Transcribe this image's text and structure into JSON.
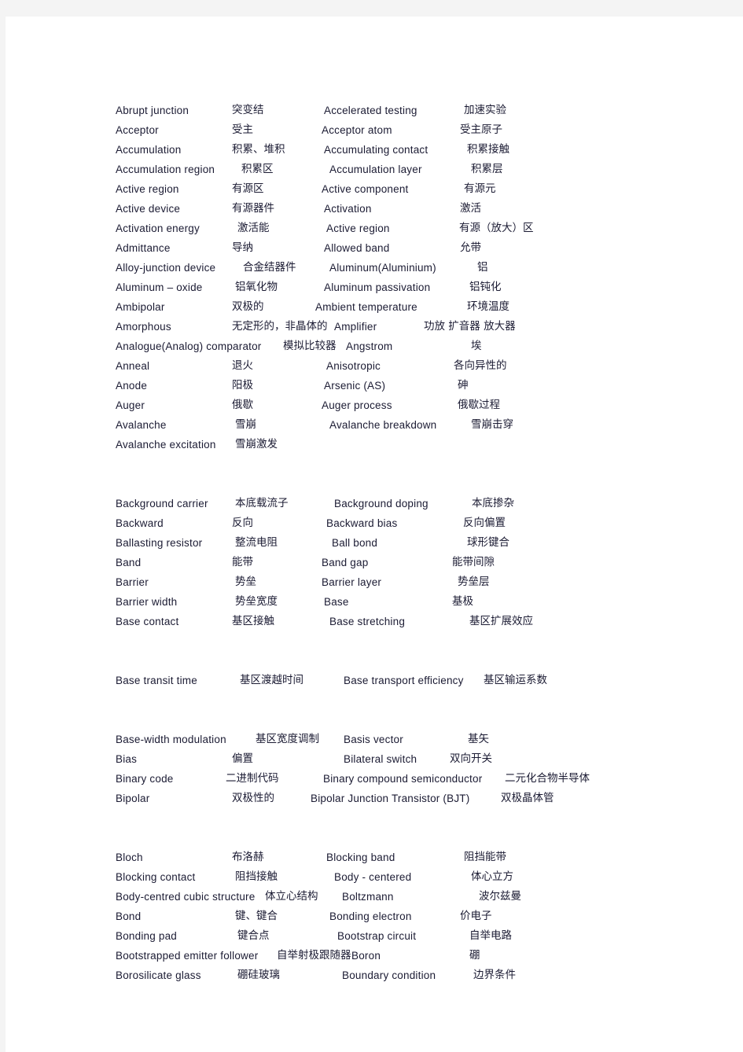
{
  "document": {
    "type": "glossary",
    "description": "English-Chinese semiconductor terminology glossary page",
    "page_background": "#ffffff",
    "margin_background": "#f4f4f4",
    "text_color": "#1b1b33"
  },
  "blocks": [
    {
      "id": "block-a",
      "rows": [
        {
          "term_en": "Abrupt junction",
          "term_zh": "突变结",
          "term2_en": "Accelerated testing",
          "term2_zh": "加速实验",
          "x": [
            0,
            148,
            265,
            443
          ]
        },
        {
          "term_en": "Acceptor",
          "term_zh": "受主",
          "term2_en": "Acceptor atom",
          "term2_zh": "受主原子",
          "x": [
            0,
            148,
            262,
            438
          ]
        },
        {
          "term_en": "Accumulation",
          "term_zh": "积累、堆积",
          "term2_en": "Accumulating contact",
          "term2_zh": "积累接触",
          "x": [
            0,
            148,
            265,
            447
          ]
        },
        {
          "term_en": "Accumulation region",
          "term_zh": "积累区",
          "term2_en": "Accumulation layer",
          "term2_zh": "积累层",
          "x": [
            0,
            160,
            272,
            452
          ]
        },
        {
          "term_en": "Active region",
          "term_zh": "有源区",
          "term2_en": "Active component",
          "term2_zh": "有源元",
          "x": [
            0,
            148,
            262,
            443
          ]
        },
        {
          "term_en": "Active device",
          "term_zh": "有源器件",
          "term2_en": "Activation",
          "term2_zh": "激活",
          "x": [
            0,
            148,
            265,
            438
          ]
        },
        {
          "term_en": "Activation energy",
          "term_zh": "激活能",
          "term2_en": "Active region",
          "term2_zh": "有源（放大）区",
          "x": [
            0,
            155,
            268,
            437
          ]
        },
        {
          "term_en": "Admittance",
          "term_zh": "导纳",
          "term2_en": "Allowed band",
          "term2_zh": "允带",
          "x": [
            0,
            148,
            265,
            438
          ]
        },
        {
          "term_en": "Alloy-junction device",
          "term_zh": "合金结器件",
          "term2_en": "Aluminum(Aluminium)",
          "term2_zh": "铝",
          "x": [
            0,
            162,
            272,
            460
          ]
        },
        {
          "term_en": "Aluminum – oxide",
          "term_zh": "铝氧化物",
          "term2_en": "Aluminum passivation",
          "term2_zh": "铝钝化",
          "x": [
            0,
            152,
            265,
            450
          ]
        },
        {
          "term_en": "Ambipolar",
          "term_zh": "双极的",
          "term2_en": "Ambient temperature",
          "term2_zh": "环境温度",
          "x": [
            0,
            148,
            254,
            447
          ]
        },
        {
          "term_en": "Amorphous",
          "term_zh": "无定形的，非晶体的",
          "term2_en": "Amplifier",
          "term2_zh": "功放 扩音器 放大器",
          "x": [
            0,
            148,
            278,
            392
          ]
        },
        {
          "term_en": "Analogue(Analog) comparator",
          "term_zh": "模拟比较器",
          "term2_en": "Angstrom",
          "term2_zh": "埃",
          "x": [
            0,
            213,
            293,
            452
          ]
        },
        {
          "term_en": "Anneal",
          "term_zh": "退火",
          "term2_en": "Anisotropic",
          "term2_zh": "各向异性的",
          "x": [
            0,
            148,
            268,
            430
          ]
        },
        {
          "term_en": "Anode",
          "term_zh": "阳极",
          "term2_en": "Arsenic (AS)",
          "term2_zh": "砷",
          "x": [
            0,
            148,
            265,
            435
          ]
        },
        {
          "term_en": "Auger",
          "term_zh": "俄歇",
          "term2_en": "Auger process",
          "term2_zh": "俄歇过程",
          "x": [
            0,
            148,
            262,
            435
          ]
        },
        {
          "term_en": "Avalanche",
          "term_zh": "雪崩",
          "term2_en": "Avalanche breakdown",
          "term2_zh": "雪崩击穿",
          "x": [
            0,
            152,
            272,
            452
          ]
        },
        {
          "term_en": "Avalanche excitation",
          "term_zh": "雪崩激发",
          "term2_en": "",
          "term2_zh": "",
          "x": [
            0,
            152,
            0,
            0
          ]
        }
      ]
    },
    {
      "id": "block-b",
      "rows": [
        {
          "term_en": "Background carrier",
          "term_zh": "本底载流子",
          "term2_en": "Background doping",
          "term2_zh": "本底掺杂",
          "x": [
            0,
            152,
            278,
            453
          ]
        },
        {
          "term_en": "Backward",
          "term_zh": "反向",
          "term2_en": "Backward bias",
          "term2_zh": "反向偏置",
          "x": [
            0,
            148,
            268,
            442
          ]
        },
        {
          "term_en": "Ballasting resistor",
          "term_zh": "整流电阻",
          "term2_en": "Ball bond",
          "term2_zh": "球形键合",
          "x": [
            0,
            152,
            275,
            447
          ]
        },
        {
          "term_en": "Band",
          "term_zh": "能带",
          "term2_en": "Band gap",
          "term2_zh": "能带间隙",
          "x": [
            0,
            148,
            262,
            428
          ]
        },
        {
          "term_en": "Barrier",
          "term_zh": "势垒",
          "term2_en": "Barrier layer",
          "term2_zh": "势垒层",
          "x": [
            0,
            152,
            262,
            435
          ]
        },
        {
          "term_en": "Barrier width",
          "term_zh": "势垒宽度",
          "term2_en": "Base",
          "term2_zh": "基极",
          "x": [
            0,
            152,
            265,
            428
          ]
        },
        {
          "term_en": "Base contact",
          "term_zh": "基区接触",
          "term2_en": "Base stretching",
          "term2_zh": "基区扩展效应",
          "x": [
            0,
            148,
            272,
            450
          ]
        }
      ]
    },
    {
      "id": "block-c",
      "rows": [
        {
          "term_en": "Base transit time",
          "term_zh": "基区渡越时间",
          "term2_en": "Base transport efficiency",
          "term2_zh": "基区输运系数",
          "x": [
            0,
            158,
            290,
            468
          ]
        }
      ]
    },
    {
      "id": "block-d",
      "rows": [
        {
          "term_en": "Base-width modulation",
          "term_zh": "基区宽度调制",
          "term2_en": "Basis vector",
          "term2_zh": "基矢",
          "x": [
            0,
            178,
            290,
            448
          ]
        },
        {
          "term_en": "Bias",
          "term_zh": "偏置",
          "term2_en": "Bilateral switch",
          "term2_zh": "双向开关",
          "x": [
            0,
            148,
            290,
            425
          ]
        },
        {
          "term_en": "Binary code",
          "term_zh": "二进制代码",
          "term2_en": "Binary compound semiconductor",
          "term2_zh": "二元化合物半导体",
          "x": [
            0,
            140,
            264,
            495
          ]
        },
        {
          "term_en": "Bipolar",
          "term_zh": "双极性的",
          "term2_en": "Bipolar Junction Transistor (BJT)",
          "term2_zh": "双极晶体管",
          "x": [
            0,
            148,
            248,
            490
          ]
        }
      ]
    },
    {
      "id": "block-e",
      "rows": [
        {
          "term_en": "Bloch",
          "term_zh": "布洛赫",
          "term2_en": "Blocking band",
          "term2_zh": "阻挡能带",
          "x": [
            0,
            148,
            268,
            443
          ]
        },
        {
          "term_en": "Blocking contact",
          "term_zh": "阻挡接触",
          "term2_en": "Body - centered",
          "term2_zh": "体心立方",
          "x": [
            0,
            152,
            278,
            452
          ]
        },
        {
          "term_en": "Body-centred cubic structure",
          "term_zh": "体立心结构",
          "term2_en": "Boltzmann",
          "term2_zh": "波尔兹曼",
          "x": [
            0,
            190,
            288,
            462
          ]
        },
        {
          "term_en": "Bond",
          "term_zh": "键、键合",
          "term2_en": "Bonding electron",
          "term2_zh": "价电子",
          "x": [
            0,
            152,
            272,
            438
          ]
        },
        {
          "term_en": "Bonding pad",
          "term_zh": "键合点",
          "term2_en": "Bootstrap circuit",
          "term2_zh": "自举电路",
          "x": [
            0,
            155,
            282,
            450
          ]
        },
        {
          "term_en": "Bootstrapped emitter follower",
          "term_zh": "自举射极跟随器",
          "term2_en": "Boron",
          "term2_zh": "硼",
          "x": [
            0,
            205,
            300,
            450
          ]
        },
        {
          "term_en": "Borosilicate glass",
          "term_zh": "硼硅玻璃",
          "term2_en": "Boundary condition",
          "term2_zh": "边界条件",
          "x": [
            0,
            155,
            288,
            455
          ]
        }
      ]
    }
  ]
}
